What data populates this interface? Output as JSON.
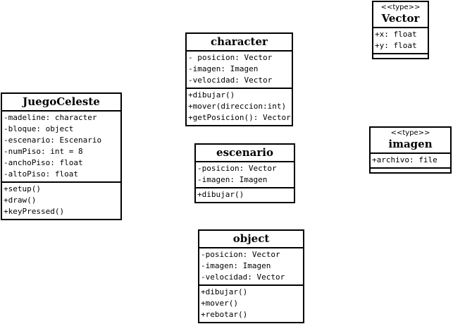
{
  "classes": {
    "vector": {
      "stereotype": "<<type>>",
      "name": "Vector",
      "attributes": [
        "+x: float",
        "+y: float"
      ],
      "methods": []
    },
    "character": {
      "name": "character",
      "attributes": [
        "- posicion: Vector",
        "-imagen: Imagen",
        "-velocidad: Vector"
      ],
      "methods": [
        "+dibujar()",
        "+mover(direccion:int)",
        "+getPosicion(): Vector"
      ]
    },
    "juego": {
      "name": "JuegoCeleste",
      "attributes": [
        "-madeline: character",
        "-bloque: object",
        "-escenario: Escenario",
        "-numPiso: int = 8",
        "-anchoPiso: float",
        "-altoPiso: float"
      ],
      "methods": [
        "+setup()",
        "+draw()",
        "+keyPressed()"
      ]
    },
    "escenario": {
      "name": "escenario",
      "attributes": [
        "-posicion: Vector",
        "-imagen: Imagen"
      ],
      "methods": [
        "+dibujar()"
      ]
    },
    "imagen": {
      "stereotype": "<<type>>",
      "name": "imagen",
      "attributes": [
        "+archivo: file"
      ],
      "methods": []
    },
    "object": {
      "name": "object",
      "attributes": [
        "-posicion: Vector",
        "-imagen: Imagen",
        "-velocidad: Vector"
      ],
      "methods": [
        "+dibujar()",
        "+mover()",
        "+rebotar()"
      ]
    }
  }
}
